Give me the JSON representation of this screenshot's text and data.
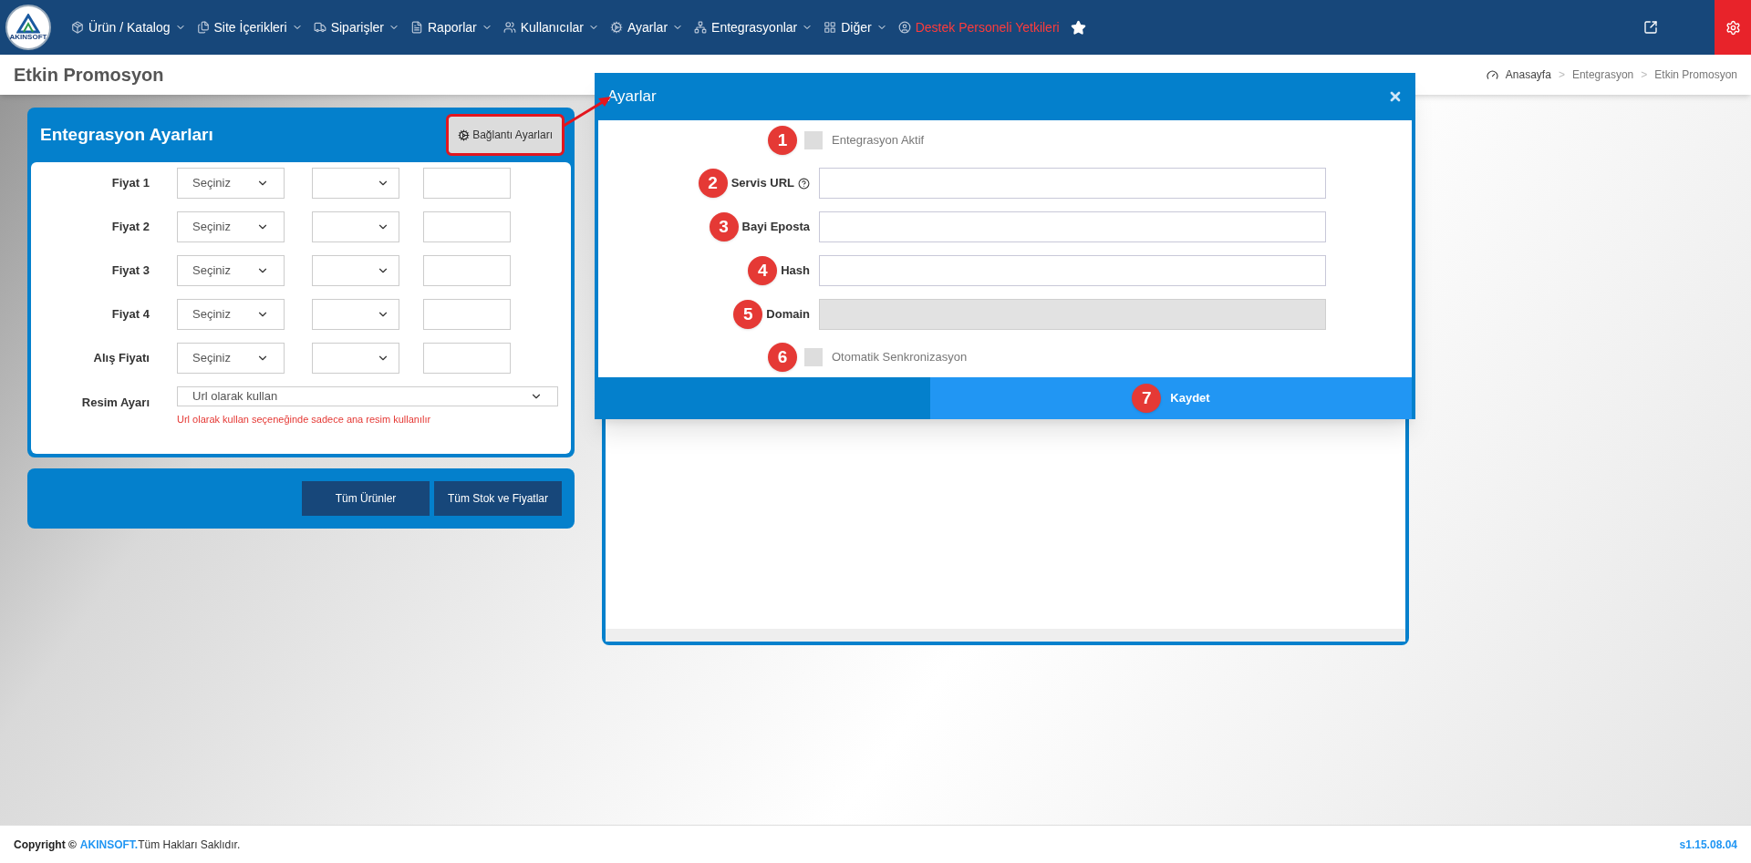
{
  "nav": {
    "logo_text": "AKINSOFT",
    "items": [
      {
        "label": "Ürün / Katalog",
        "kind": "menu"
      },
      {
        "label": "Site İçerikleri",
        "kind": "menu"
      },
      {
        "label": "Siparişler",
        "kind": "menu"
      },
      {
        "label": "Raporlar",
        "kind": "menu"
      },
      {
        "label": "Kullanıcılar",
        "kind": "menu"
      },
      {
        "label": "Ayarlar",
        "kind": "menu"
      },
      {
        "label": "Entegrasyonlar",
        "kind": "menu"
      },
      {
        "label": "Diğer",
        "kind": "menu"
      },
      {
        "label": "Destek Personeli Yetkileri",
        "kind": "alert"
      },
      {
        "kind": "star"
      }
    ]
  },
  "page": {
    "title": "Etkin Promosyon",
    "breadcrumb": [
      "Anasayfa",
      "Entegrasyon",
      "Etkin Promosyon"
    ],
    "breadcrumb_separator": ">"
  },
  "settings_panel": {
    "title": "Entegrasyon Ayarları",
    "connection_button": "Bağlantı Ayarları",
    "highlighted": true,
    "price_rows": [
      {
        "label": "Fiyat 1",
        "select": "Seçiniz"
      },
      {
        "label": "Fiyat 2",
        "select": "Seçiniz"
      },
      {
        "label": "Fiyat 3",
        "select": "Seçiniz"
      },
      {
        "label": "Fiyat 4",
        "select": "Seçiniz"
      },
      {
        "label": "Alış Fiyatı",
        "select": "Seçiniz"
      }
    ],
    "image_row": {
      "label": "Resim Ayarı",
      "value": "Url olarak kullan",
      "hint": "Url olarak kullan seçeneğinde sadece ana resim kullanılır"
    },
    "actions": [
      "Tüm Ürünler",
      "Tüm Stok ve Fiyatlar"
    ]
  },
  "modal": {
    "title": "Ayarlar",
    "fields": [
      {
        "kind": "checkbox",
        "marker": "1",
        "label": "Entegrasyon Aktif",
        "checked": false
      },
      {
        "kind": "text_with_help",
        "marker": "2",
        "label": "Servis URL",
        "disabled": false
      },
      {
        "kind": "text",
        "marker": "3",
        "label": "Bayi Eposta",
        "disabled": false
      },
      {
        "kind": "text",
        "marker": "4",
        "label": "Hash",
        "disabled": false
      },
      {
        "kind": "text",
        "marker": "5",
        "label": "Domain",
        "disabled": true
      },
      {
        "kind": "checkbox",
        "marker": "6",
        "label": "Otomatik Senkronizasyon",
        "checked": false
      }
    ],
    "save": {
      "label": "Kaydet",
      "marker": "7"
    }
  },
  "footer": {
    "copyright": "Copyright ©",
    "brand": "AKINSOFT.",
    "rights": "Tüm Hakları Saklıdır.",
    "version": "s1.15.08.04"
  }
}
